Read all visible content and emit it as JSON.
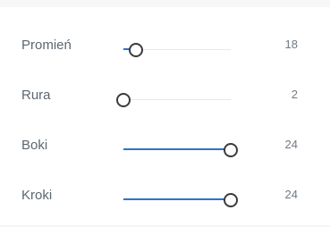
{
  "sliders": [
    {
      "label": "Promień",
      "value": "18",
      "level": 0.12
    },
    {
      "label": "Rura",
      "value": "2",
      "level": 0.0
    },
    {
      "label": "Boki",
      "value": "24",
      "level": 1.0
    },
    {
      "label": "Kroki",
      "value": "24",
      "level": 1.0
    }
  ],
  "colors": {
    "accent": "#2e73c9",
    "track": "#e4e9ec",
    "thumb_border": "#3b3b3b",
    "label": "#5b6770"
  }
}
